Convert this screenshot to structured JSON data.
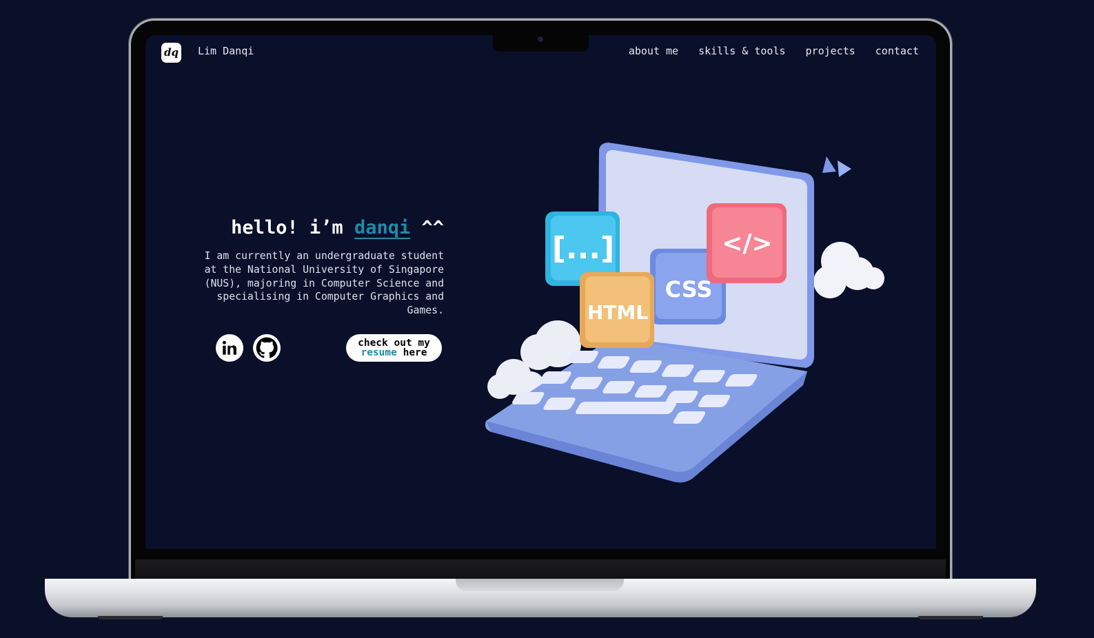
{
  "nav": {
    "logo": "dq",
    "brand": "Lim Danqi",
    "links": [
      "about me",
      "skills & tools",
      "projects",
      "contact"
    ]
  },
  "hero": {
    "greeting_pre": "hello! i’m ",
    "greeting_name": "danqi",
    "greeting_post": " ^^",
    "intro": "I am currently an undergraduate student at the National University of Singapore (NUS), majoring in Computer Science and specialising in Computer Graphics and Games."
  },
  "social": {
    "linkedin_icon": "linkedin-icon",
    "github_icon": "github-icon"
  },
  "resume_button": {
    "line1": "check out my",
    "highlight": "resume",
    "line2_rest": " here"
  },
  "illustration": {
    "tile_brackets": "[...]",
    "tile_html": "HTML",
    "tile_css": "CSS",
    "tile_code": "</>"
  },
  "colors": {
    "background": "#0a0f2a",
    "accent": "#1f8aa6",
    "text": "#e7e9f3"
  }
}
